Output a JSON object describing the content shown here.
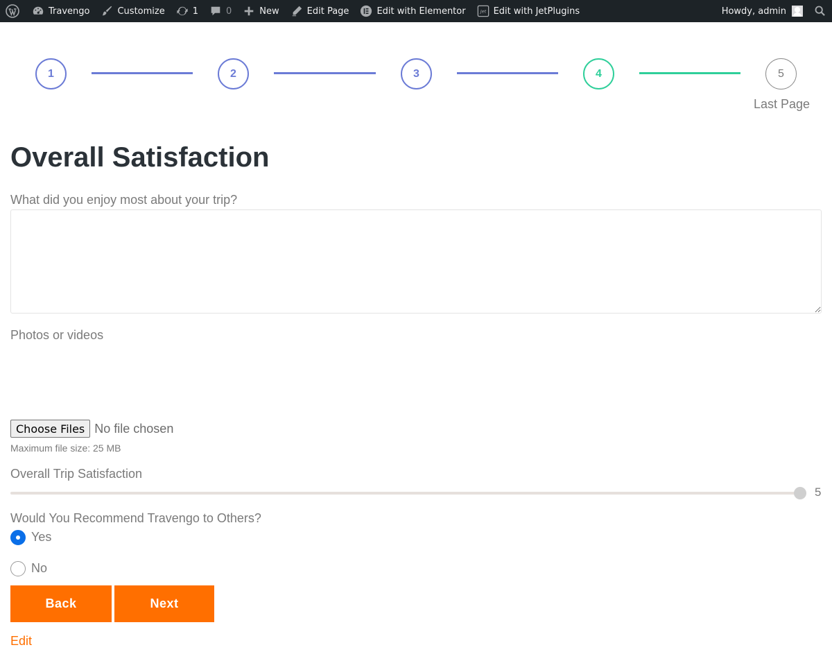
{
  "adminbar": {
    "site_name": "Travengo",
    "customize": "Customize",
    "updates_count": "1",
    "comments_count": "0",
    "new_label": "New",
    "edit_page": "Edit Page",
    "edit_elementor": "Edit with Elementor",
    "edit_jetplugins": "Edit with JetPlugins",
    "howdy": "Howdy, admin"
  },
  "steps": {
    "items": [
      {
        "number": "1",
        "state": "done"
      },
      {
        "number": "2",
        "state": "done"
      },
      {
        "number": "3",
        "state": "done"
      },
      {
        "number": "4",
        "state": "active"
      },
      {
        "number": "5",
        "state": "todo",
        "label": "Last Page"
      }
    ],
    "done_color": "#6b7bd6",
    "active_color": "#2fcf9a"
  },
  "form": {
    "title": "Overall Satisfaction",
    "enjoy_label": "What did you enjoy most about your trip?",
    "enjoy_value": "",
    "photos_label": "Photos or videos",
    "file_button": "Choose Files",
    "file_status": "No file chosen",
    "file_hint": "Maximum file size: 25 MB",
    "satisfaction_label": "Overall Trip Satisfaction",
    "satisfaction_value": "5",
    "satisfaction_fraction": 1.0,
    "recommend_label": "Would You Recommend Travengo to Others?",
    "options": [
      {
        "label": "Yes",
        "checked": true
      },
      {
        "label": "No",
        "checked": false
      }
    ],
    "back_button": "Back",
    "next_button": "Next",
    "edit_link": "Edit"
  },
  "colors": {
    "accent": "#ff6f00",
    "radio_checked": "#0a6fe8",
    "adminbar_bg": "#1d2327"
  }
}
